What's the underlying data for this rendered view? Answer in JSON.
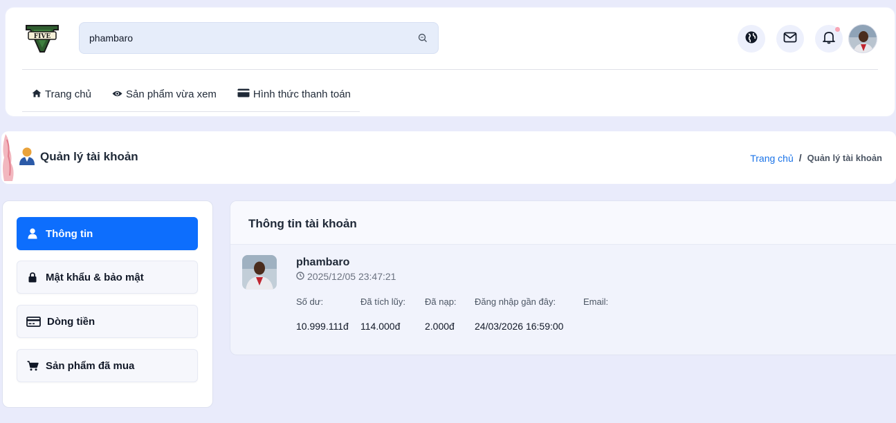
{
  "header": {
    "logo_alt": "GTA Five logo",
    "search": {
      "value": "phambaro",
      "placeholder": ""
    },
    "icons": [
      "globe-icon",
      "mail-icon",
      "bell-icon"
    ],
    "nav": [
      {
        "icon": "home-icon",
        "label": "Trang chủ"
      },
      {
        "icon": "eye-icon",
        "label": "Sản phẩm vừa xem"
      },
      {
        "icon": "credit-card-icon",
        "label": "Hình thức thanh toán"
      }
    ]
  },
  "titlebar": {
    "title": "Quản lý tài khoản",
    "breadcrumb": {
      "home": "Trang chủ",
      "separator": "/",
      "current": "Quản lý tài khoản"
    }
  },
  "sidebar": {
    "items": [
      {
        "icon": "user-icon",
        "label": "Thông tin",
        "active": true
      },
      {
        "icon": "lock-icon",
        "label": "Mật khẩu & bảo mật",
        "active": false
      },
      {
        "icon": "credit-card-icon",
        "label": "Dòng tiền",
        "active": false
      },
      {
        "icon": "cart-icon",
        "label": "Sản phẩm đã mua",
        "active": false
      }
    ]
  },
  "account": {
    "title": "Thông tin tài khoản",
    "username": "phambaro",
    "created": "2025/12/05 23:47:21",
    "stats": [
      {
        "label": "Số dư:",
        "value": "10.999.111đ"
      },
      {
        "label": "Đã tích lũy:",
        "value": "114.000đ"
      },
      {
        "label": "Đã nạp:",
        "value": "2.000đ"
      },
      {
        "label": "Đăng nhập gần đây:",
        "value": "24/03/2026 16:59:00"
      },
      {
        "label": "Email:",
        "value": ""
      }
    ]
  },
  "colors": {
    "accent": "#0d6efd",
    "link": "#1a73e8",
    "page_bg": "#e9ebfb",
    "notification_dot": "#f8a5b5"
  }
}
